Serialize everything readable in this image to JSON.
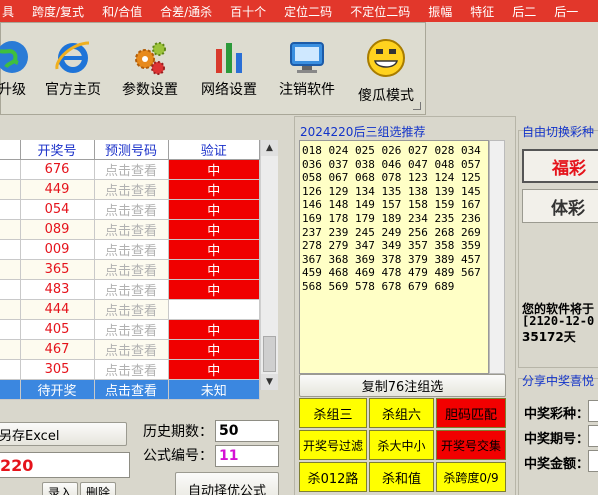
{
  "menubar": {
    "items": [
      "具",
      "跨度/复式",
      "和/合值",
      "合差/通杀",
      "百十个",
      "定位二码",
      "不定位二码",
      "振幅",
      "特征",
      "后二",
      "后一"
    ]
  },
  "toolbar": {
    "buttons": [
      {
        "label": "升级",
        "icon": "globe-icon"
      },
      {
        "label": "官方主页",
        "icon": "ie-icon"
      },
      {
        "label": "参数设置",
        "icon": "gears-icon"
      },
      {
        "label": "网络设置",
        "icon": "bars-icon"
      },
      {
        "label": "注销软件",
        "icon": "monitor-icon"
      },
      {
        "label": "傻瓜模式",
        "icon": "smiley-icon"
      }
    ]
  },
  "grid": {
    "headers": [
      "开奖号",
      "预测号码",
      "验证"
    ],
    "rows": [
      {
        "num": "676",
        "pred": "点击查看",
        "ver": "中"
      },
      {
        "num": "449",
        "pred": "点击查看",
        "ver": "中"
      },
      {
        "num": "054",
        "pred": "点击查看",
        "ver": "中"
      },
      {
        "num": "089",
        "pred": "点击查看",
        "ver": "中"
      },
      {
        "num": "009",
        "pred": "点击查看",
        "ver": "中"
      },
      {
        "num": "365",
        "pred": "点击查看",
        "ver": "中"
      },
      {
        "num": "483",
        "pred": "点击查看",
        "ver": "中"
      },
      {
        "num": "444",
        "pred": "点击查看",
        "ver": ""
      },
      {
        "num": "405",
        "pred": "点击查看",
        "ver": "中"
      },
      {
        "num": "467",
        "pred": "点击查看",
        "ver": "中"
      },
      {
        "num": "305",
        "pred": "点击查看",
        "ver": "中"
      }
    ],
    "current": {
      "num": "待开奖",
      "pred": "点击查看",
      "ver": "未知"
    }
  },
  "bottom_left": {
    "excel_btn": "另存Excel",
    "history_label": "历史期数：",
    "history_value": "50",
    "formula_label": "公式编号：",
    "formula_value": "11",
    "period_value": "220",
    "record_btn": "录入",
    "delete_btn": "删除",
    "auto_btn": "自动择优公式"
  },
  "recommend": {
    "title": "2024220后三组选推荐",
    "numbers": "018 024 025 026 027 028 034 036 037 038 046 047 048 057 058 067 068 078 123 124 125 126 129 134 135 138 139 145 146 148 149 157 158 159 167 169 178 179 189 234 235 236 237 239 245 249 256 268 269 278 279 347 349 357 358 359 367 368 369 378 379 389 457 459 468 469 478 479 489 567 568 569 578 678 679 689",
    "copy_btn": "复制76注组选",
    "buttons": [
      {
        "label": "杀组三",
        "red": false
      },
      {
        "label": "杀组六",
        "red": false
      },
      {
        "label": "胆码匹配",
        "red": true
      },
      {
        "label": "开奖号过滤",
        "red": false
      },
      {
        "label": "杀大中小",
        "red": false
      },
      {
        "label": "开奖号交集",
        "red": true
      },
      {
        "label": "杀012路",
        "red": false
      },
      {
        "label": "杀和值",
        "red": false
      },
      {
        "label": "杀跨度0/9",
        "red": false
      }
    ]
  },
  "right_panel": {
    "switch_title": "自由切换彩种",
    "fucai_label": "福彩",
    "ticai_label": "体彩",
    "software_text": "您的软件将于",
    "date_text": "[2120-12-0",
    "days_text": "35172天",
    "share_title": "分享中奖喜悦",
    "prize_type_label": "中奖彩种：",
    "prize_period_label": "中奖期号：",
    "prize_amount_label": "中奖金额："
  },
  "colors": {
    "menubar": "#e2372b",
    "verify_hit": "#f20000",
    "current_row": "#3b87e0",
    "recommend_bg": "#ffffc6",
    "button_yellow": "#ffff00"
  }
}
